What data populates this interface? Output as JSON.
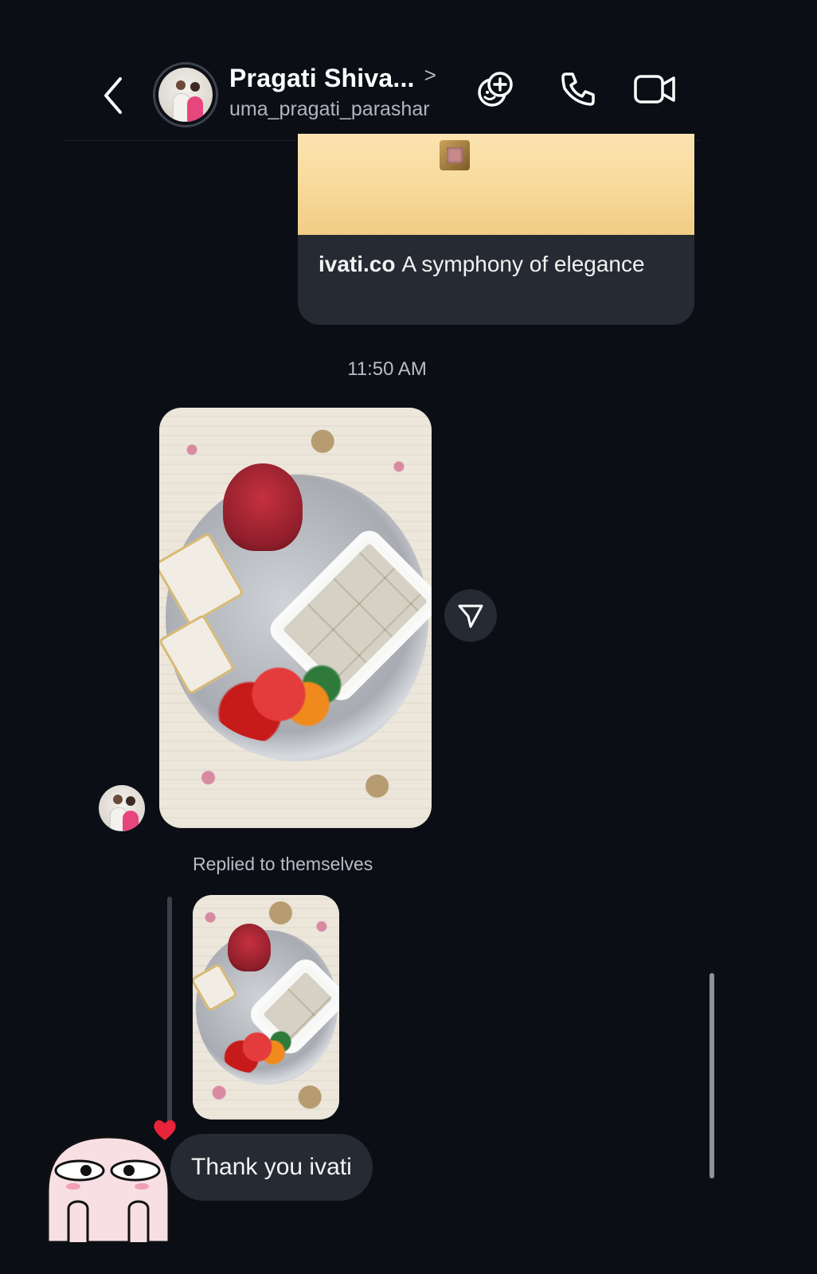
{
  "header": {
    "contact_name": "Pragati Shiva...",
    "chevron": ">",
    "username": "uma_pragati_parashar",
    "icons": [
      "back-arrow-icon",
      "avatar-effects-icon",
      "phone-icon",
      "video-camera-icon"
    ]
  },
  "link_share": {
    "domain": "ivati.co",
    "caption": "A symphony of elegance"
  },
  "thread": {
    "timestamp": "11:50 AM",
    "replied_label": "Replied to themselves",
    "message_text": "Thank you ivati",
    "reaction": "heart"
  },
  "colors": {
    "background": "#0b0e15",
    "bubble": "#262a33",
    "muted_text": "#b8bcc4",
    "reaction_heart": "#e8243a"
  }
}
